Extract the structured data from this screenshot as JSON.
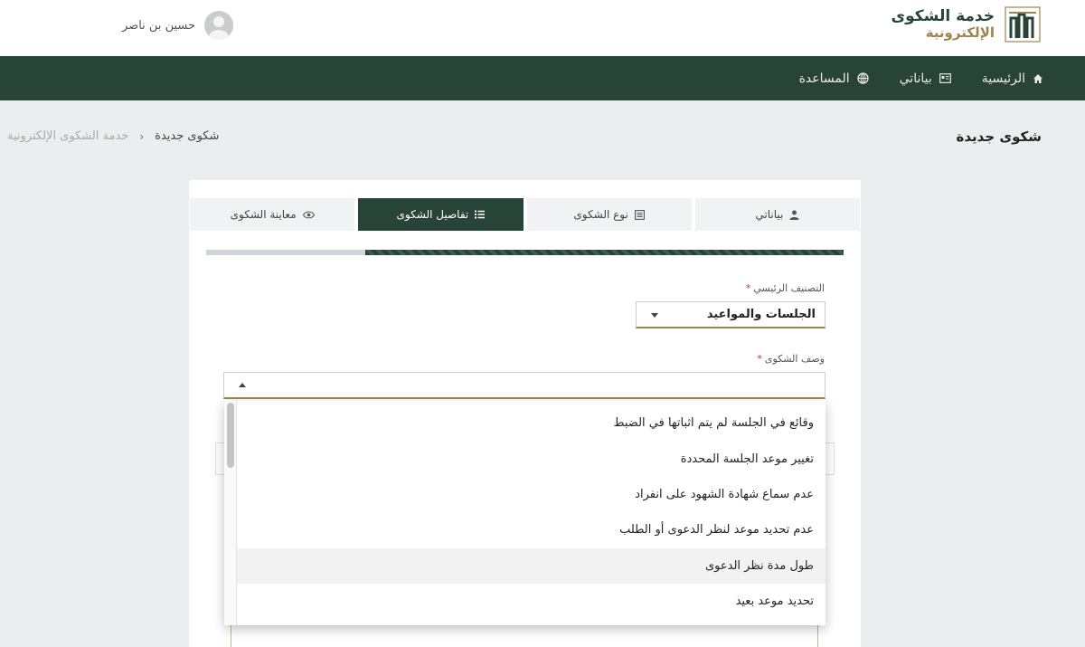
{
  "header": {
    "logo_line1": "خدمة الشكوى",
    "logo_line2": "الإلكترونية",
    "user_name": "حسين بن ناصر"
  },
  "nav": {
    "items": [
      {
        "label": "الرئيسية",
        "icon": "home-icon"
      },
      {
        "label": "بياناتي",
        "icon": "id-card-icon"
      },
      {
        "label": "المساعدة",
        "icon": "globe-icon"
      }
    ]
  },
  "page": {
    "title": "شكوى جديدة",
    "breadcrumb": {
      "root": "خدمة الشكوى الإلكترونية",
      "separator": "‹",
      "current": "شكوى جديدة"
    }
  },
  "tabs": [
    {
      "label": "بياناتي",
      "icon": "user-icon",
      "active": false
    },
    {
      "label": "نوع الشكوى",
      "icon": "document-icon",
      "active": false
    },
    {
      "label": "تفاصيل الشكوى",
      "icon": "list-icon",
      "active": true
    },
    {
      "label": "معاينة الشكوى",
      "icon": "eye-icon",
      "active": false
    }
  ],
  "progress": {
    "fraction_complete": 0.75
  },
  "form": {
    "main_category_label": "التصنيف الرئيسي",
    "main_category_value": "الجلسات والمواعيد",
    "description_label": "وصف الشكوى",
    "required_mark": "*"
  },
  "dropdown": {
    "options": [
      "وقائع في الجلسة لم يتم اثباتها في الضبط",
      "تغيير موعد الجلسة المحددة",
      "عدم سماع شهادة الشهود على انفراد",
      "عدم تحديد موعد لنظر الدعوى أو الطلب",
      "طول مدة نظر الدعوى",
      "تحديد موعد بعيد"
    ],
    "hovered_index": 4
  },
  "colors": {
    "primary_green": "#284337",
    "gold_accent": "#a1844d",
    "background": "#ebedef"
  }
}
